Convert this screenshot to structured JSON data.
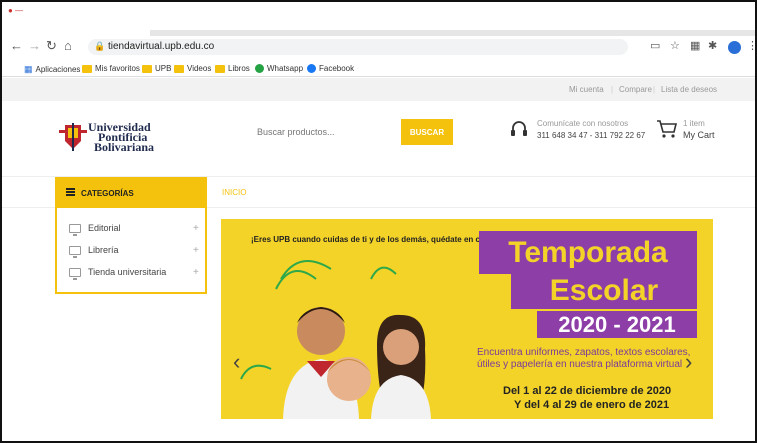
{
  "browser": {
    "url": "tiendavirtual.upb.edu.co",
    "bookmarks": [
      "Aplicaciones",
      "Mis favoritos",
      "UPB",
      "Videos",
      "Libros",
      "Whatsapp",
      "Facebook"
    ]
  },
  "topbar": {
    "account": "Mi cuenta",
    "compare": "Compare",
    "wishlist": "Lista de deseos"
  },
  "logo": {
    "line1": "Universidad",
    "line2": "Pontificia",
    "line3": "Bolivariana"
  },
  "search": {
    "placeholder": "Buscar productos...",
    "button": "BUSCAR"
  },
  "contact": {
    "label": "Comunícate con nosotros",
    "phones": "311 648 34 47 - 311 792 22 67"
  },
  "cart": {
    "count": "1 item",
    "label": "My Cart"
  },
  "nav": {
    "categories": "CATEGORÍAS",
    "home": "INICIO"
  },
  "categories": [
    {
      "label": "Editorial"
    },
    {
      "label": "Librería"
    },
    {
      "label": "Tienda universitaria"
    }
  ],
  "banner": {
    "tagline": "¡Eres UPB cuando cuidas de ti y de los demás, quédate en casa!",
    "title1": "Temporada",
    "title2": "Escolar",
    "years": "2020 - 2021",
    "subtitle": "Encuentra uniformes, zapatos, textos escolares, útiles y papelería en nuestra plataforma virtual",
    "date1": "Del 1 al 22 de diciembre de 2020",
    "date2": "Y del 4 al 29 de enero de 2021"
  },
  "colors": {
    "accent": "#f4c20d",
    "banner_bg": "#f3d328",
    "purple": "#8e3fa7",
    "brand_blue": "#1f2a4d"
  }
}
